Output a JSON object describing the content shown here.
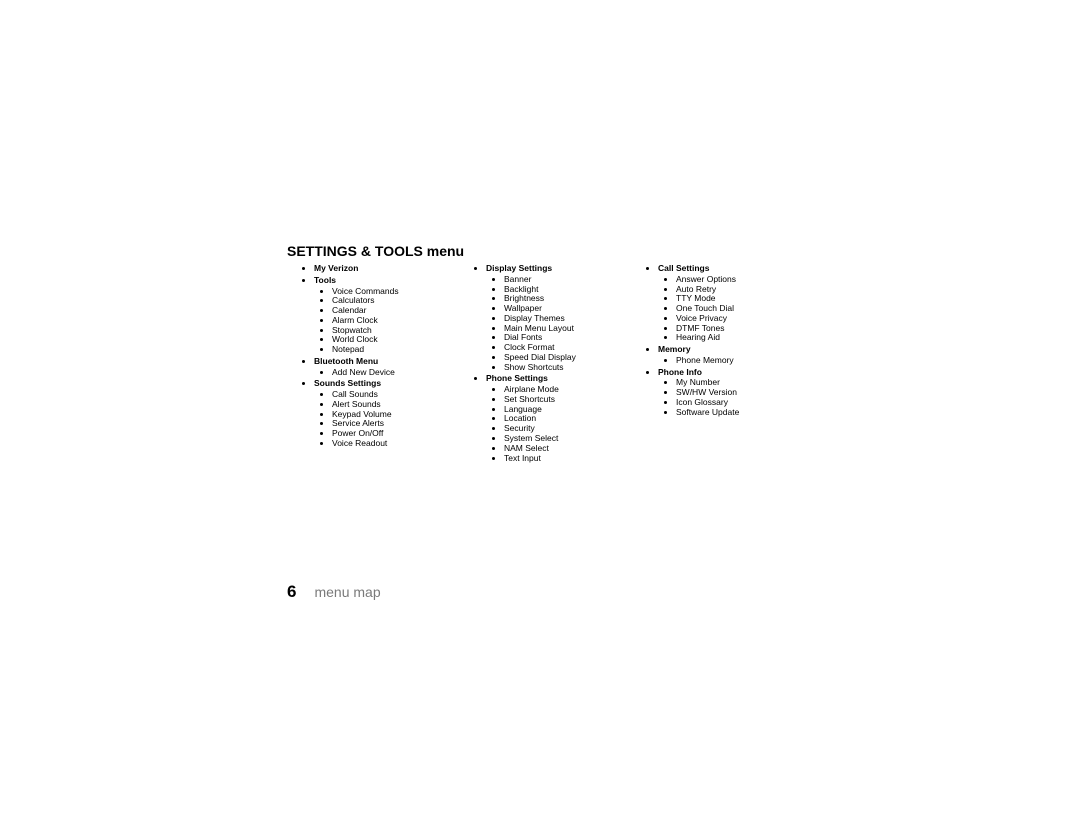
{
  "heading": "SETTINGS & TOOLS menu",
  "page_number": "6",
  "page_title": "menu map",
  "columns": [
    [
      {
        "label": "My Verizon",
        "items": []
      },
      {
        "label": "Tools",
        "items": [
          "Voice Commands",
          "Calculators",
          "Calendar",
          "Alarm Clock",
          "Stopwatch",
          "World Clock",
          "Notepad"
        ]
      },
      {
        "label": "Bluetooth Menu",
        "items": [
          "Add New Device"
        ]
      },
      {
        "label": "Sounds Settings",
        "items": [
          "Call Sounds",
          "Alert Sounds",
          "Keypad Volume",
          "Service Alerts",
          "Power On/Off",
          "Voice Readout"
        ]
      }
    ],
    [
      {
        "label": "Display Settings",
        "items": [
          "Banner",
          "Backlight",
          "Brightness",
          "Wallpaper",
          "Display Themes",
          "Main Menu Layout",
          "Dial Fonts",
          "Clock Format",
          "Speed Dial Display",
          "Show Shortcuts"
        ]
      },
      {
        "label": "Phone Settings",
        "items": [
          "Airplane Mode",
          "Set Shortcuts",
          "Language",
          "Location",
          "Security",
          "System Select",
          "NAM Select",
          "Text Input"
        ]
      }
    ],
    [
      {
        "label": "Call Settings",
        "items": [
          "Answer Options",
          "Auto Retry",
          "TTY Mode",
          "One Touch Dial",
          "Voice Privacy",
          "DTMF Tones",
          "Hearing Aid"
        ]
      },
      {
        "label": "Memory",
        "items": [
          "Phone Memory"
        ]
      },
      {
        "label": "Phone Info",
        "items": [
          "My Number",
          "SW/HW Version",
          "Icon Glossary",
          "Software Update"
        ]
      }
    ]
  ]
}
